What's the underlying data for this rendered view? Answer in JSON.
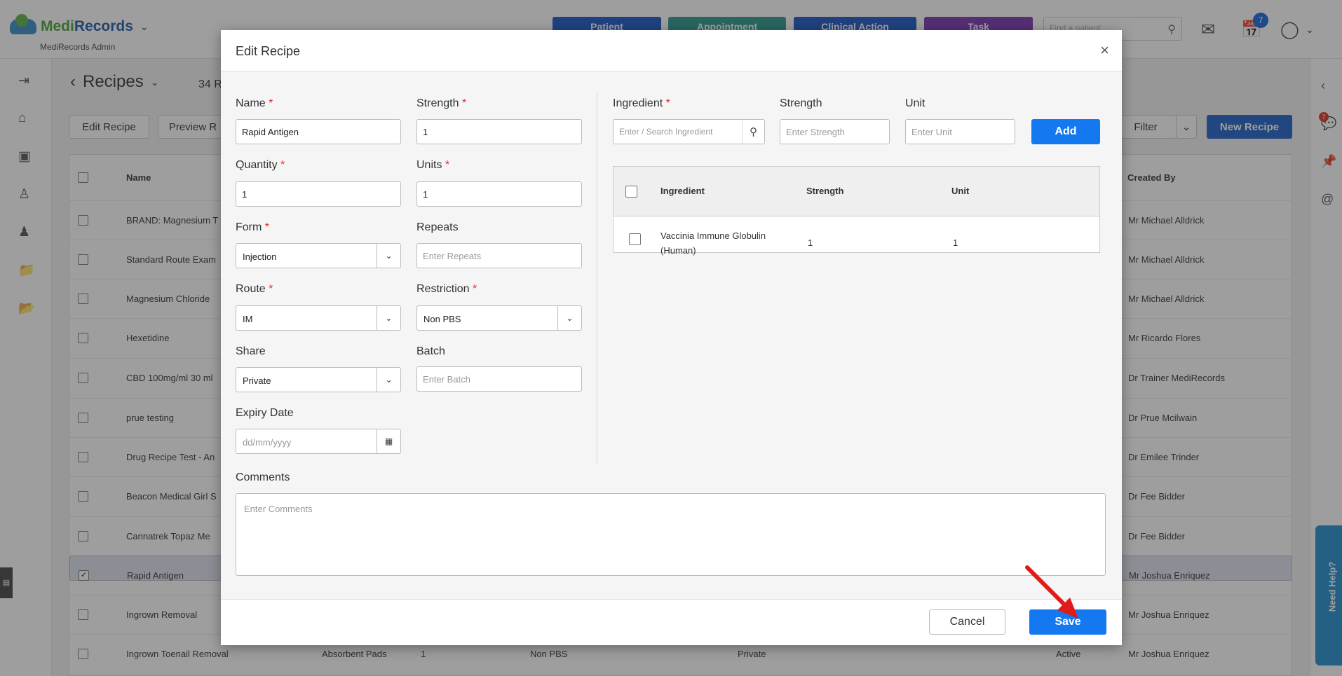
{
  "header": {
    "brand_medi": "Medi",
    "brand_records": "Records",
    "brand_sub": "MediRecords Admin",
    "buttons": [
      {
        "label": "Patient",
        "color": "#1a56c7"
      },
      {
        "label": "Appointment",
        "color": "#2a9a8c"
      },
      {
        "label": "Clinical Action",
        "color": "#1a56c7"
      },
      {
        "label": "Task",
        "color": "#7a34b3"
      }
    ],
    "search_placeholder": "Find a patient",
    "badge_count": "7",
    "right_badge_count": "7"
  },
  "page": {
    "title": "Recipes",
    "count_text": "34 R",
    "toolbar": {
      "edit_recipe": "Edit Recipe",
      "preview": "Preview R",
      "filter": "Filter",
      "new_recipe": "New Recipe"
    },
    "columns": {
      "name": "Name",
      "created_by": "Created By"
    },
    "rows": [
      {
        "name": "BRAND: Magnesium T",
        "created_by": "Mr Michael Alldrick",
        "selected": false
      },
      {
        "name": "Standard Route Exam",
        "created_by": "Mr Michael Alldrick",
        "selected": false
      },
      {
        "name": "Magnesium Chloride",
        "created_by": "Mr Michael Alldrick",
        "selected": false
      },
      {
        "name": "Hexetidine",
        "created_by": "Mr Ricardo Flores",
        "selected": false
      },
      {
        "name": "CBD 100mg/ml 30 ml",
        "created_by": "Dr Trainer MediRecords",
        "selected": false
      },
      {
        "name": "prue testing",
        "created_by": "Dr Prue Mcilwain",
        "selected": false
      },
      {
        "name": "Drug Recipe Test - An",
        "created_by": "Dr Emilee Trinder",
        "selected": false
      },
      {
        "name": "Beacon Medical Girl S",
        "created_by": "Dr Fee Bidder",
        "selected": false
      },
      {
        "name": "Cannatrek Topaz Me",
        "created_by": "Dr Fee Bidder",
        "selected": false
      },
      {
        "name": "Rapid Antigen",
        "created_by": "Mr Joshua Enriquez",
        "selected": true
      },
      {
        "name": "Ingrown Removal",
        "created_by": "Mr Joshua Enriquez",
        "selected": false
      },
      {
        "name": "Ingrown Toenail Removal",
        "created_by": "Mr Joshua Enriquez",
        "selected": false
      }
    ],
    "last_row_extra": {
      "ingredient": "Absorbent Pads",
      "qty": "1",
      "restriction": "Non PBS",
      "share": "Private",
      "status": "Active"
    }
  },
  "modal": {
    "title": "Edit Recipe",
    "close": "×",
    "fields": {
      "name": {
        "label": "Name",
        "value": "Rapid Antigen"
      },
      "strength": {
        "label": "Strength",
        "value": "1"
      },
      "quantity": {
        "label": "Quantity",
        "value": "1"
      },
      "units": {
        "label": "Units",
        "value": "1"
      },
      "form": {
        "label": "Form",
        "value": "Injection"
      },
      "repeats": {
        "label": "Repeats",
        "placeholder": "Enter Repeats"
      },
      "route": {
        "label": "Route",
        "value": "IM"
      },
      "restriction": {
        "label": "Restriction",
        "value": "Non PBS"
      },
      "share": {
        "label": "Share",
        "value": "Private"
      },
      "batch": {
        "label": "Batch",
        "placeholder": "Enter Batch"
      },
      "expiry": {
        "label": "Expiry Date",
        "placeholder": "dd/mm/yyyy"
      },
      "comments": {
        "label": "Comments",
        "placeholder": "Enter Comments"
      }
    },
    "ingredient_form": {
      "ingredient_label": "Ingredient",
      "ingredient_placeholder": "Enter / Search Ingredient",
      "strength_label": "Strength",
      "strength_placeholder": "Enter Strength",
      "unit_label": "Unit",
      "unit_placeholder": "Enter Unit",
      "add": "Add"
    },
    "ingredient_table": {
      "headers": [
        "Ingredient",
        "Strength",
        "Unit"
      ],
      "rows": [
        {
          "ingredient_line1": "Vaccinia Immune Globulin",
          "ingredient_line2": "(Human)",
          "strength": "1",
          "unit": "1"
        }
      ]
    },
    "footer": {
      "cancel": "Cancel",
      "save": "Save"
    }
  },
  "sidebar_help": "Need Help?"
}
